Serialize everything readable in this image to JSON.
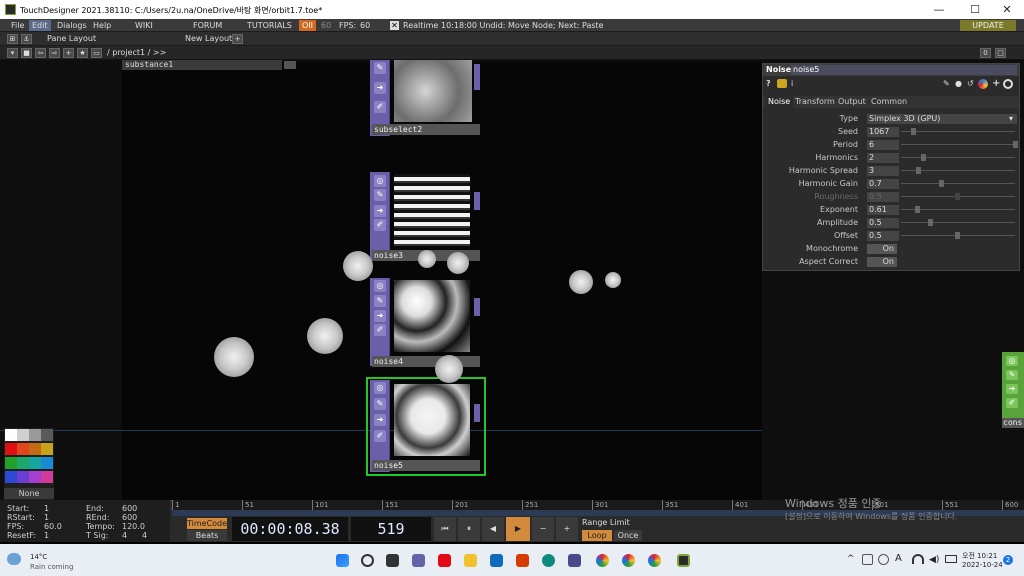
{
  "window": {
    "title": "TouchDesigner 2021.38110: C:/Users/2u.na/OneDrive/바탕 화면/orbit1.7.toe*",
    "minimize": "—",
    "maximize": "☐",
    "close": "✕"
  },
  "menu": {
    "file": "File",
    "edit": "Edit",
    "dialogs": "Dialogs",
    "help": "Help",
    "wiki": "WIKI",
    "forum": "FORUM",
    "tutorials": "TUTORIALS",
    "oi": "OII",
    "fps_a": "60",
    "fps_label": "FPS:",
    "fps_b": "60",
    "realtime": "Realtime",
    "status": "10:18:00 Undid: Move Node; Next: Paste",
    "update": "UPDATE"
  },
  "toolbar": {
    "pane_layout": "Pane Layout",
    "new_layout": "New Layout",
    "plus": "+"
  },
  "pathbar": {
    "path": "/ project1 / >>",
    "right_a": "0",
    "right_b": "□"
  },
  "network": {
    "substance_label": "substance1",
    "operators": [
      {
        "name": "subselect2"
      },
      {
        "name": "noise3"
      },
      {
        "name": "noise4"
      },
      {
        "name": "noise5"
      },
      {
        "name": "cons"
      }
    ]
  },
  "params": {
    "op_type": "Noise",
    "op_name": "noise5",
    "tabs": [
      "Noise",
      "Transform",
      "Output",
      "Common"
    ],
    "rows": [
      {
        "label": "Type",
        "value": "Simplex 3D (GPU)"
      },
      {
        "label": "Seed",
        "value": "1067"
      },
      {
        "label": "Period",
        "value": "6"
      },
      {
        "label": "Harmonics",
        "value": "2"
      },
      {
        "label": "Harmonic Spread",
        "value": "3"
      },
      {
        "label": "Harmonic Gain",
        "value": "0.7"
      },
      {
        "label": "Roughness",
        "value": "0.5"
      },
      {
        "label": "Exponent",
        "value": "0.61"
      },
      {
        "label": "Amplitude",
        "value": "0.5"
      },
      {
        "label": "Offset",
        "value": "0.5"
      },
      {
        "label": "Monochrome",
        "value": "On"
      },
      {
        "label": "Aspect Correct",
        "value": "On"
      }
    ]
  },
  "palette": {
    "none_label": "None",
    "colors": [
      "#ffffff",
      "#cfcfcf",
      "#9a9a9a",
      "#5a5a5a",
      "#d11",
      "#e0451b",
      "#c46a14",
      "#c8a318",
      "#22a02c",
      "#1ea86a",
      "#16a6a0",
      "#1b8ad4",
      "#2c49d6",
      "#6a3ed2",
      "#a43fd0",
      "#d23a9c"
    ]
  },
  "timeline": {
    "start_label": "Start:",
    "start": "1",
    "end_label": "End:",
    "end": "600",
    "rstart_label": "RStart:",
    "rstart": "1",
    "rend_label": "REnd:",
    "rend": "600",
    "fps_label": "FPS:",
    "fps": "60.0",
    "tempo_label": "Tempo:",
    "tempo": "120.0",
    "resetf_label": "ResetF:",
    "resetf": "1",
    "tsig_label": "T Sig:",
    "tsig_a": "4",
    "tsig_b": "4",
    "timecode_btn": "TimeCode",
    "beats_btn": "Beats",
    "timecode": "00:00:08.38",
    "frame": "519",
    "range_limit": "Range Limit",
    "loop": "Loop",
    "once": "Once",
    "ruler": [
      "1",
      "51",
      "101",
      "151",
      "201",
      "251",
      "301",
      "351",
      "401",
      "451",
      "501",
      "551",
      "600"
    ]
  },
  "watermark": {
    "line1": "Windows 정품 인증",
    "line2": "[설정]으로 이동하여 Windows를 정품 인증합니다."
  },
  "taskbar": {
    "temp": "14°C",
    "weather": "Rain coming",
    "time": "오전 10:21",
    "date": "2022-10-24",
    "lang": "A",
    "badge": "2"
  }
}
